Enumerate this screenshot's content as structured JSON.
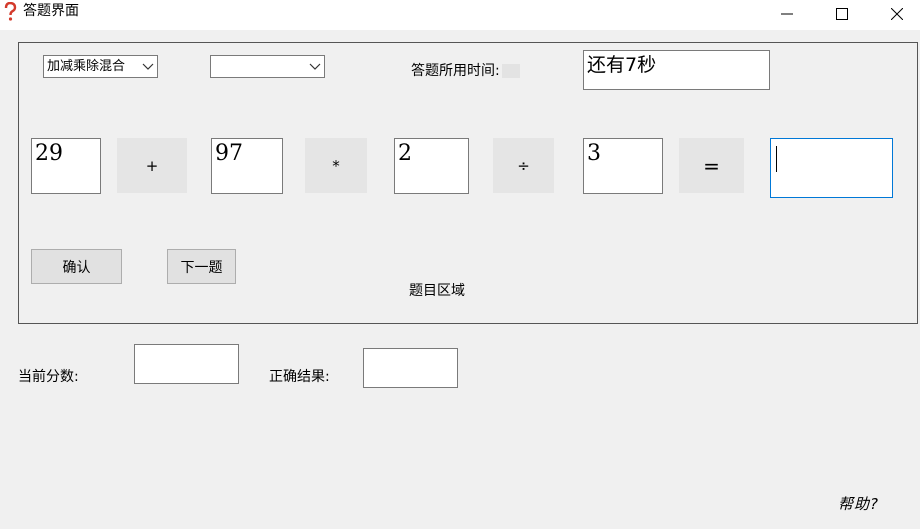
{
  "window": {
    "title": "答题界面",
    "icon": "question-icon",
    "controls": {
      "minimize": "—",
      "maximize": "☐",
      "close": "✕"
    }
  },
  "quiz_area": {
    "label": "题目区域",
    "mode_select": {
      "value": "加减乘除混合"
    },
    "difficulty_select": {
      "value": ""
    },
    "timer_label": "答题所用时间:",
    "timer_value": "还有7秒",
    "expression": {
      "operand1": "29",
      "op1": "+",
      "operand2": "97",
      "op2": "*",
      "operand3": "2",
      "op3": "÷",
      "operand4": "3",
      "equals": "=",
      "answer": ""
    },
    "confirm_label": "确认",
    "next_label": "下一题"
  },
  "footer": {
    "score_label": "当前分数:",
    "score_value": "",
    "result_label": "正确结果:",
    "result_value": "",
    "help_label": "帮助?"
  },
  "colors": {
    "window_bg": "#f0f0f0",
    "focus_border": "#0078d7"
  }
}
